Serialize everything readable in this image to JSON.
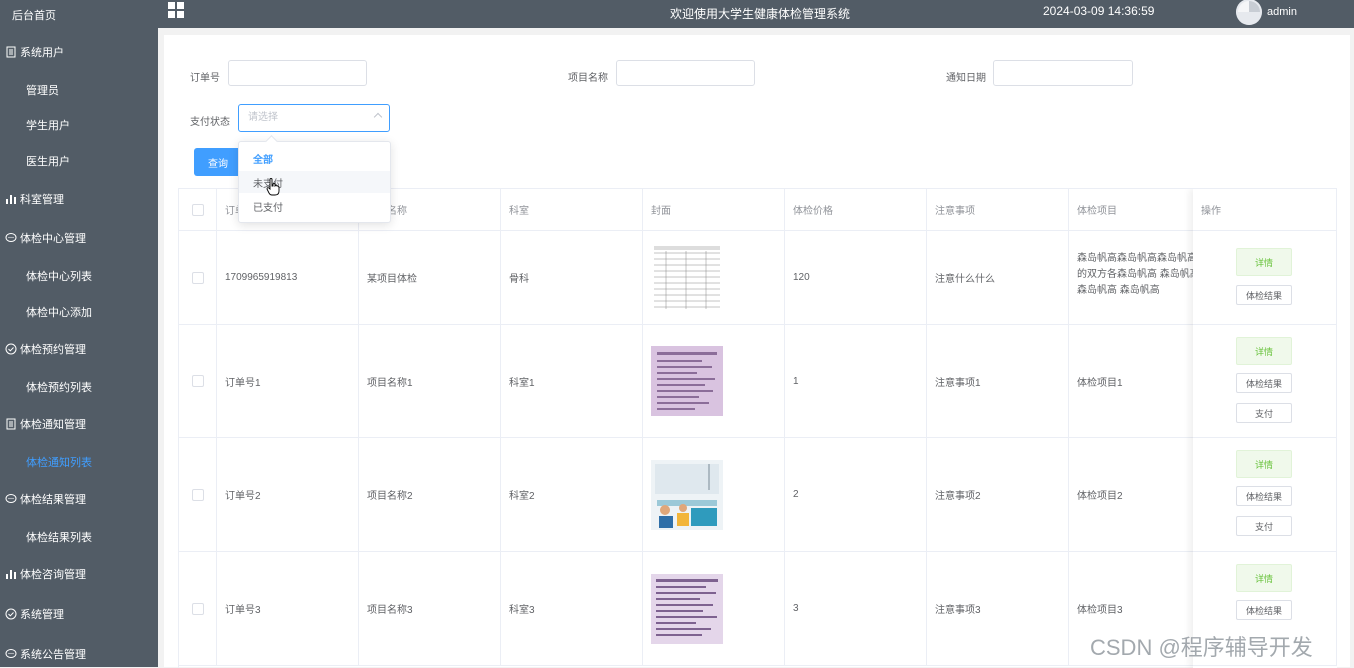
{
  "sidebar": {
    "home": "后台首页",
    "groups": [
      {
        "label": "系统用户",
        "icon": "document-icon",
        "items": [
          "管理员",
          "学生用户",
          "医生用户"
        ]
      },
      {
        "label": "科室管理",
        "icon": "bar-chart-icon",
        "items": []
      },
      {
        "label": "体检中心管理",
        "icon": "chat-icon",
        "items": [
          "体检中心列表",
          "体检中心添加"
        ]
      },
      {
        "label": "体检预约管理",
        "icon": "check-circle-icon",
        "items": [
          "体检预约列表"
        ]
      },
      {
        "label": "体检通知管理",
        "icon": "document-icon",
        "items": [
          "体检通知列表"
        ]
      },
      {
        "label": "体检结果管理",
        "icon": "chat-icon",
        "items": [
          "体检结果列表"
        ]
      },
      {
        "label": "体检咨询管理",
        "icon": "bar-chart-icon",
        "items": []
      },
      {
        "label": "系统管理",
        "icon": "check-circle-icon",
        "items": []
      },
      {
        "label": "系统公告管理",
        "icon": "chat-icon",
        "items": []
      }
    ],
    "active_item": "体检通知列表"
  },
  "header": {
    "title": "欢迎使用大学生健康体检管理系统",
    "datetime": "2024-03-09 14:36:59",
    "username": "admin"
  },
  "search": {
    "order_label": "订单号",
    "project_label": "项目名称",
    "date_label": "通知日期",
    "pay_label": "支付状态",
    "pay_placeholder": "请选择",
    "query_button": "查询"
  },
  "dropdown": {
    "options": [
      "全部",
      "未支付",
      "已支付"
    ],
    "selected": "全部",
    "hovered": "未支付"
  },
  "table": {
    "headers": [
      "订单号",
      "项目名称",
      "科室",
      "封面",
      "体检价格",
      "注意事项",
      "体检项目",
      "操作"
    ],
    "rows": [
      {
        "order": "1709965919813",
        "project": "某项目体检",
        "dept": "骨科",
        "price": "120",
        "notes": "注意什么什么",
        "items": "森岛帆高森岛帆高森岛帆高的双方各森岛帆高 森岛帆高森岛帆高 森岛帆高",
        "buttons": [
          "详情",
          "体检结果"
        ]
      },
      {
        "order": "订单号1",
        "project": "项目名称1",
        "dept": "科室1",
        "price": "1",
        "notes": "注意事项1",
        "items": "体检项目1",
        "buttons": [
          "详情",
          "体检结果",
          "支付"
        ]
      },
      {
        "order": "订单号2",
        "project": "项目名称2",
        "dept": "科室2",
        "price": "2",
        "notes": "注意事项2",
        "items": "体检项目2",
        "buttons": [
          "详情",
          "体检结果",
          "支付"
        ]
      },
      {
        "order": "订单号3",
        "project": "项目名称3",
        "dept": "科室3",
        "price": "3",
        "notes": "注意事项3",
        "items": "体检项目3",
        "buttons": [
          "详情",
          "体检结果"
        ]
      }
    ]
  },
  "watermark": "CSDN @程序辅导开发",
  "colors": {
    "sidebar_bg": "#525c66",
    "primary": "#409eff",
    "success": "#67c23a"
  }
}
